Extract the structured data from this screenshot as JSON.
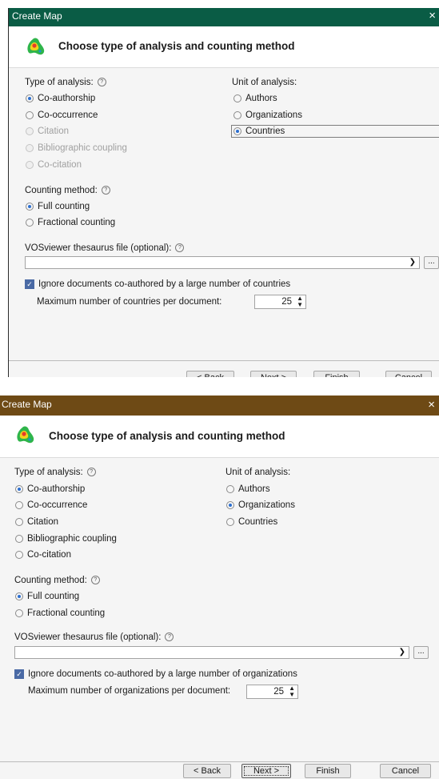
{
  "dialogs": [
    {
      "title": "Create Map",
      "close": "×",
      "titlebar_color": "#0a5c45",
      "heading": "Choose type of analysis and counting method",
      "type_label": "Type of analysis:",
      "types": [
        "Co-authorship",
        "Co-occurrence",
        "Citation",
        "Bibliographic coupling",
        "Co-citation"
      ],
      "unit_label": "Unit of analysis:",
      "units": [
        "Authors",
        "Organizations",
        "Countries"
      ],
      "counting_label": "Counting method:",
      "counting": [
        "Full counting",
        "Fractional counting"
      ],
      "thesaurus_label": "VOSviewer thesaurus file (optional):",
      "thesaurus_value": "",
      "browse": "...",
      "ignore_label": "Ignore documents co-authored by a large number of countries",
      "max_label": "Maximum number of countries per document:",
      "max_value": "25",
      "buttons": {
        "back": "< Back",
        "next": "Next >",
        "finish": "Finish",
        "cancel": "Cancel"
      }
    },
    {
      "title": "Create Map",
      "close": "×",
      "titlebar_color": "#6e4a15",
      "heading": "Choose type of analysis and counting method",
      "type_label": "Type of analysis:",
      "types": [
        "Co-authorship",
        "Co-occurrence",
        "Citation",
        "Bibliographic coupling",
        "Co-citation"
      ],
      "unit_label": "Unit of analysis:",
      "units": [
        "Authors",
        "Organizations",
        "Countries"
      ],
      "counting_label": "Counting method:",
      "counting": [
        "Full counting",
        "Fractional counting"
      ],
      "thesaurus_label": "VOSviewer thesaurus file (optional):",
      "thesaurus_value": "",
      "browse": "...",
      "ignore_label": "Ignore documents co-authored by a large number of organizations",
      "max_label": "Maximum number of organizations per document:",
      "max_value": "25",
      "buttons": {
        "back": "< Back",
        "next": "Next >",
        "finish": "Finish",
        "cancel": "Cancel"
      }
    }
  ]
}
